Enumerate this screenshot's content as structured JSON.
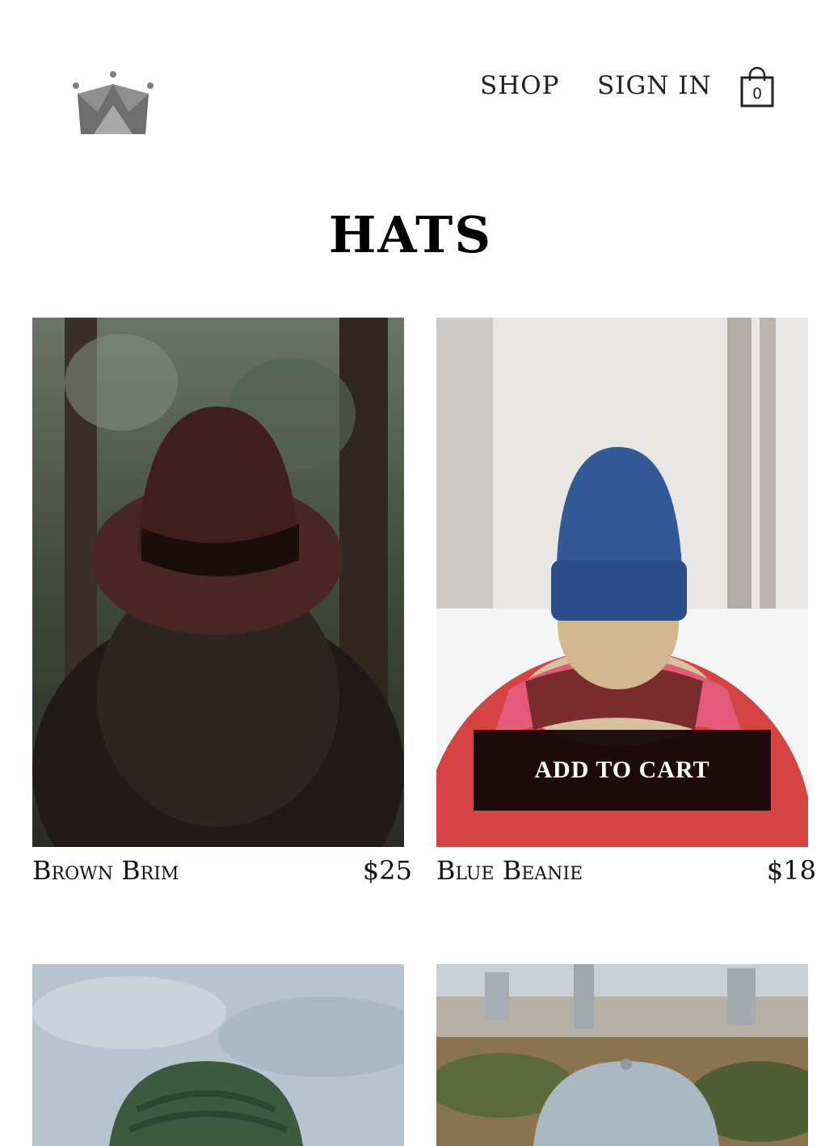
{
  "header": {
    "nav": {
      "shop_label": "SHOP",
      "signin_label": "SIGN IN"
    },
    "cart": {
      "count": "0"
    }
  },
  "page": {
    "title": "HATS"
  },
  "products": [
    {
      "name": "Brown Brim",
      "price": "$25"
    },
    {
      "name": "Blue Beanie",
      "price": "$18"
    },
    {
      "name": "",
      "price": ""
    },
    {
      "name": "",
      "price": ""
    }
  ],
  "add_to_cart_label": "ADD TO CART",
  "colors": {
    "logo": "#808080",
    "button_bg": "#140608",
    "text": "#111111"
  },
  "icons": {
    "logo": "crown-logo-icon",
    "cart": "shopping-bag-icon"
  }
}
